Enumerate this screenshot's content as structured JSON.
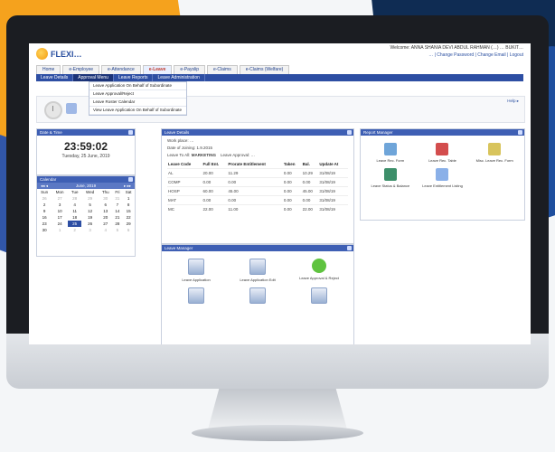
{
  "header": {
    "logo_text": "FLEXI…",
    "welcome_line": "Welcome: ANNA SHANIA DEVI ABDUL RAHMAN (…)  …  BUKIT…",
    "links_line": "… | Change Password | Change Email | Logout"
  },
  "menu": [
    {
      "label": "Home"
    },
    {
      "label": "e-Employee"
    },
    {
      "label": "e-Attendance"
    },
    {
      "label": "e-Leave",
      "active": true
    },
    {
      "label": "e-Payslip"
    },
    {
      "label": "e-Claims"
    },
    {
      "label": "e-Claims (Welfare)"
    }
  ],
  "submenu": [
    {
      "label": "Leave Details"
    },
    {
      "label": "Approval Menu",
      "active": true
    },
    {
      "label": "Leave Reports"
    },
    {
      "label": "Leave Administration"
    }
  ],
  "dropdown": [
    "Leave Application On Behalf of Subordinate",
    "Leave Approval/Reject",
    "Leave Roster Calendar",
    "View Leave Application On Behalf of Subordinate"
  ],
  "infobar": {
    "right_text": "Help ▸"
  },
  "date_time": {
    "title": "Date & Time",
    "time": "23:59:02",
    "date": "Tuesday, 25 June, 2019"
  },
  "calendar": {
    "title": "Calendar",
    "month": "June, 2019",
    "weekdays": [
      "Sun",
      "Mon",
      "Tue",
      "Wed",
      "Thu",
      "Fri",
      "Sat"
    ],
    "weeks": [
      [
        "26",
        "27",
        "28",
        "29",
        "30",
        "31",
        "1"
      ],
      [
        "2",
        "3",
        "4",
        "5",
        "6",
        "7",
        "8"
      ],
      [
        "9",
        "10",
        "11",
        "12",
        "13",
        "14",
        "15"
      ],
      [
        "16",
        "17",
        "18",
        "19",
        "20",
        "21",
        "22"
      ],
      [
        "23",
        "24",
        "25",
        "26",
        "27",
        "28",
        "29"
      ],
      [
        "30",
        "1",
        "2",
        "3",
        "4",
        "5",
        "6"
      ]
    ],
    "today": "25"
  },
  "leave_details": {
    "title": "Leave Details",
    "work_place_label": "Work place:",
    "work_place": "…",
    "date_of_joining_label": "Date of Joining:",
    "date_of_joining": "1.9.2015",
    "leave_to_all_label": "Leave To All:",
    "leave_to_all": "MARKETING",
    "approver_label": "Leave Approval:",
    "approver": "…",
    "columns": [
      "Leave Code",
      "Full Ent.",
      "Prorate Entitlement",
      "Taken",
      "Bal.",
      "Update At"
    ],
    "rows": [
      [
        "AL",
        "20.00",
        "11.29",
        "0.00",
        "10.29",
        "31/08/19"
      ],
      [
        "COMP",
        "0.00",
        "0.00",
        "0.00",
        "0.00",
        "31/08/19"
      ],
      [
        "HOSP",
        "60.00",
        "45.00",
        "0.00",
        "45.00",
        "31/08/19"
      ],
      [
        "MAT",
        "0.00",
        "0.00",
        "0.00",
        "0.00",
        "31/08/19"
      ],
      [
        "MC",
        "22.00",
        "11.00",
        "0.00",
        "22.00",
        "31/08/19"
      ]
    ]
  },
  "leave_manager": {
    "title": "Leave Manager",
    "items": [
      {
        "label": "Leave Application"
      },
      {
        "label": "Leave Application Edit"
      },
      {
        "label": "Leave Approval & Reject"
      },
      {
        "label": ""
      },
      {
        "label": ""
      },
      {
        "label": ""
      }
    ]
  },
  "report_manager": {
    "title": "Report Manager",
    "items": [
      {
        "label": "Leave Rec. Form"
      },
      {
        "label": "Leave Rec. Table"
      },
      {
        "label": "Misc. Leave Rec. Form"
      },
      {
        "label": "Leave Status & Balance"
      },
      {
        "label": "Leave Entitlement Listing"
      }
    ]
  }
}
